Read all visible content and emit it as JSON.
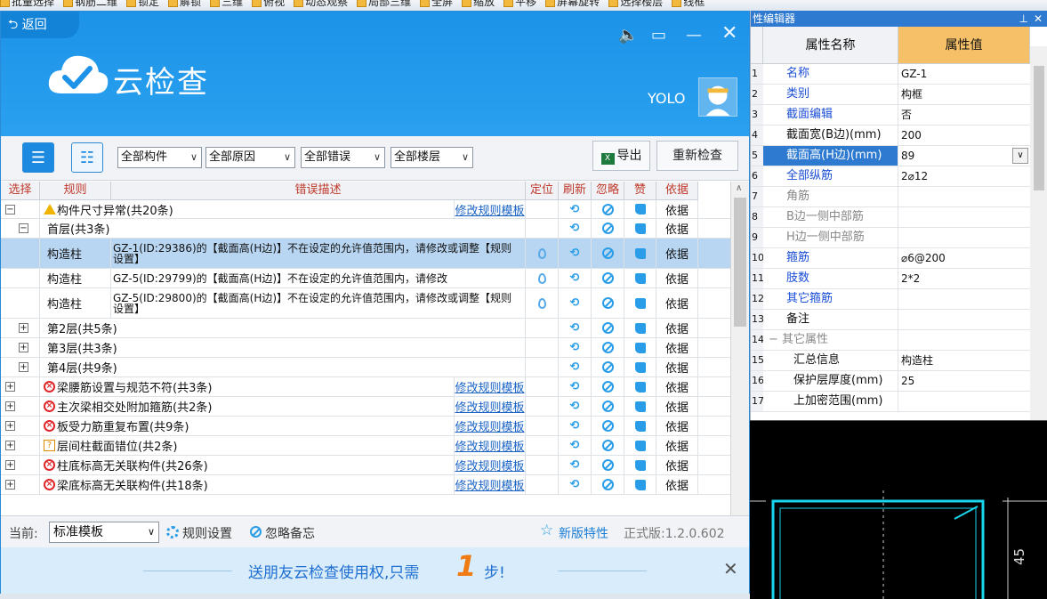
{
  "toolbar": {
    "items": [
      "批量选择",
      "钢筋二维",
      "锁定",
      "解锁",
      "三维",
      "俯视",
      "动态观察",
      "局部三维",
      "全屏",
      "缩放",
      "平移",
      "屏幕旋转",
      "选择楼层",
      "线框"
    ]
  },
  "dialog": {
    "back_label": "返回",
    "brand": "云检查",
    "user": "YOLO",
    "filters": [
      "全部构件",
      "全部原因",
      "全部错误",
      "全部楼层"
    ],
    "export_label": "导出",
    "recheck_label": "重新检查",
    "columns": [
      "选择",
      "规则",
      "错误描述",
      "定位",
      "刷新",
      "忽略",
      "赞",
      "依据"
    ],
    "rows": [
      {
        "expand": "−",
        "icon": "warn",
        "rule": "构件尺寸异常(共20条)",
        "link": "修改规则模板",
        "basis": "依据",
        "pin": false
      },
      {
        "expand": "−",
        "indent": 1,
        "rule": "首层(共3条)",
        "basis": "依据",
        "pin": false
      },
      {
        "rule": "构造柱",
        "desc": "GZ-1(ID:29386)的【截面高(H边)】不在设定的允许值范围内，请修改或调整【规则设置】",
        "basis": "依据",
        "pin": true,
        "selected": true
      },
      {
        "rule": "构造柱",
        "desc": "GZ-5(ID:29799)的【截面高(H边)】不在设定的允许值范围内，请修改",
        "basis": "依据",
        "pin": true
      },
      {
        "rule": "构造柱",
        "desc": "GZ-5(ID:29800)的【截面高(H边)】不在设定的允许值范围内，请修改或调整【规则设置】",
        "basis": "依据",
        "pin": true
      },
      {
        "expand": "+",
        "indent": 1,
        "rule": "第2层(共5条)",
        "basis": "依据"
      },
      {
        "expand": "+",
        "indent": 1,
        "rule": "第3层(共3条)",
        "basis": "依据"
      },
      {
        "expand": "+",
        "indent": 1,
        "rule": "第4层(共9条)",
        "basis": "依据"
      },
      {
        "expand": "+",
        "icon": "err",
        "rule": "梁腰筋设置与规范不符(共3条)",
        "link": "修改规则模板",
        "basis": "依据"
      },
      {
        "expand": "+",
        "icon": "err",
        "rule": "主次梁相交处附加箍筋(共2条)",
        "link": "修改规则模板",
        "basis": "依据"
      },
      {
        "expand": "+",
        "icon": "err",
        "rule": "板受力筋重复布置(共9条)",
        "link": "修改规则模板",
        "basis": "依据"
      },
      {
        "expand": "+",
        "icon": "q",
        "rule": "层间柱截面错位(共2条)",
        "link": "修改规则模板",
        "basis": "依据"
      },
      {
        "expand": "+",
        "icon": "err",
        "rule": "柱底标高无关联构件(共26条)",
        "link": "修改规则模板",
        "basis": "依据"
      },
      {
        "expand": "+",
        "icon": "err",
        "rule": "梁底标高无关联构件(共18条)",
        "link": "修改规则模板",
        "basis": "依据"
      }
    ],
    "status": {
      "current_label": "当前:",
      "template": "标准模板",
      "rule_settings": "规则设置",
      "ignore_memo": "忽略备忘",
      "new_features": "新版特性",
      "version": "正式版:1.2.0.602"
    },
    "promo": {
      "text": "送朋友云检查使用权,只需",
      "number": "1",
      "step": "步!"
    }
  },
  "property_editor": {
    "title": "性编辑器",
    "col_name": "属性名称",
    "col_value": "属性值",
    "rows": [
      {
        "n": "1",
        "name": "名称",
        "value": "GZ-1",
        "style": "blue"
      },
      {
        "n": "2",
        "name": "类别",
        "value": "构框",
        "style": "blue"
      },
      {
        "n": "3",
        "name": "截面编辑",
        "value": "否",
        "style": "blue"
      },
      {
        "n": "4",
        "name": "截面宽(B边)(mm)",
        "value": "200",
        "style": "black"
      },
      {
        "n": "5",
        "name": "截面高(H边)(mm)",
        "value": "89",
        "style": "sel"
      },
      {
        "n": "6",
        "name": "全部纵筋",
        "value": "2⌀12",
        "style": "blue"
      },
      {
        "n": "7",
        "name": "角筋",
        "value": "",
        "style": "gray"
      },
      {
        "n": "8",
        "name": "B边一侧中部筋",
        "value": "",
        "style": "gray"
      },
      {
        "n": "9",
        "name": "H边一侧中部筋",
        "value": "",
        "style": "gray"
      },
      {
        "n": "10",
        "name": "箍筋",
        "value": "⌀6@200",
        "style": "blue"
      },
      {
        "n": "11",
        "name": "肢数",
        "value": "2*2",
        "style": "blue"
      },
      {
        "n": "12",
        "name": "其它箍筋",
        "value": "",
        "style": "blue"
      },
      {
        "n": "13",
        "name": "备注",
        "value": "",
        "style": "black"
      },
      {
        "n": "14",
        "name": "− 其它属性",
        "value": "",
        "style": "gray"
      },
      {
        "n": "15",
        "name": "汇总信息",
        "value": "构造柱",
        "style": "black"
      },
      {
        "n": "16",
        "name": "保护层厚度(mm)",
        "value": "25",
        "style": "black"
      },
      {
        "n": "17",
        "name": "上加密范围(mm)",
        "value": "",
        "style": "black"
      }
    ]
  },
  "canvas": {
    "dimension": "45"
  }
}
